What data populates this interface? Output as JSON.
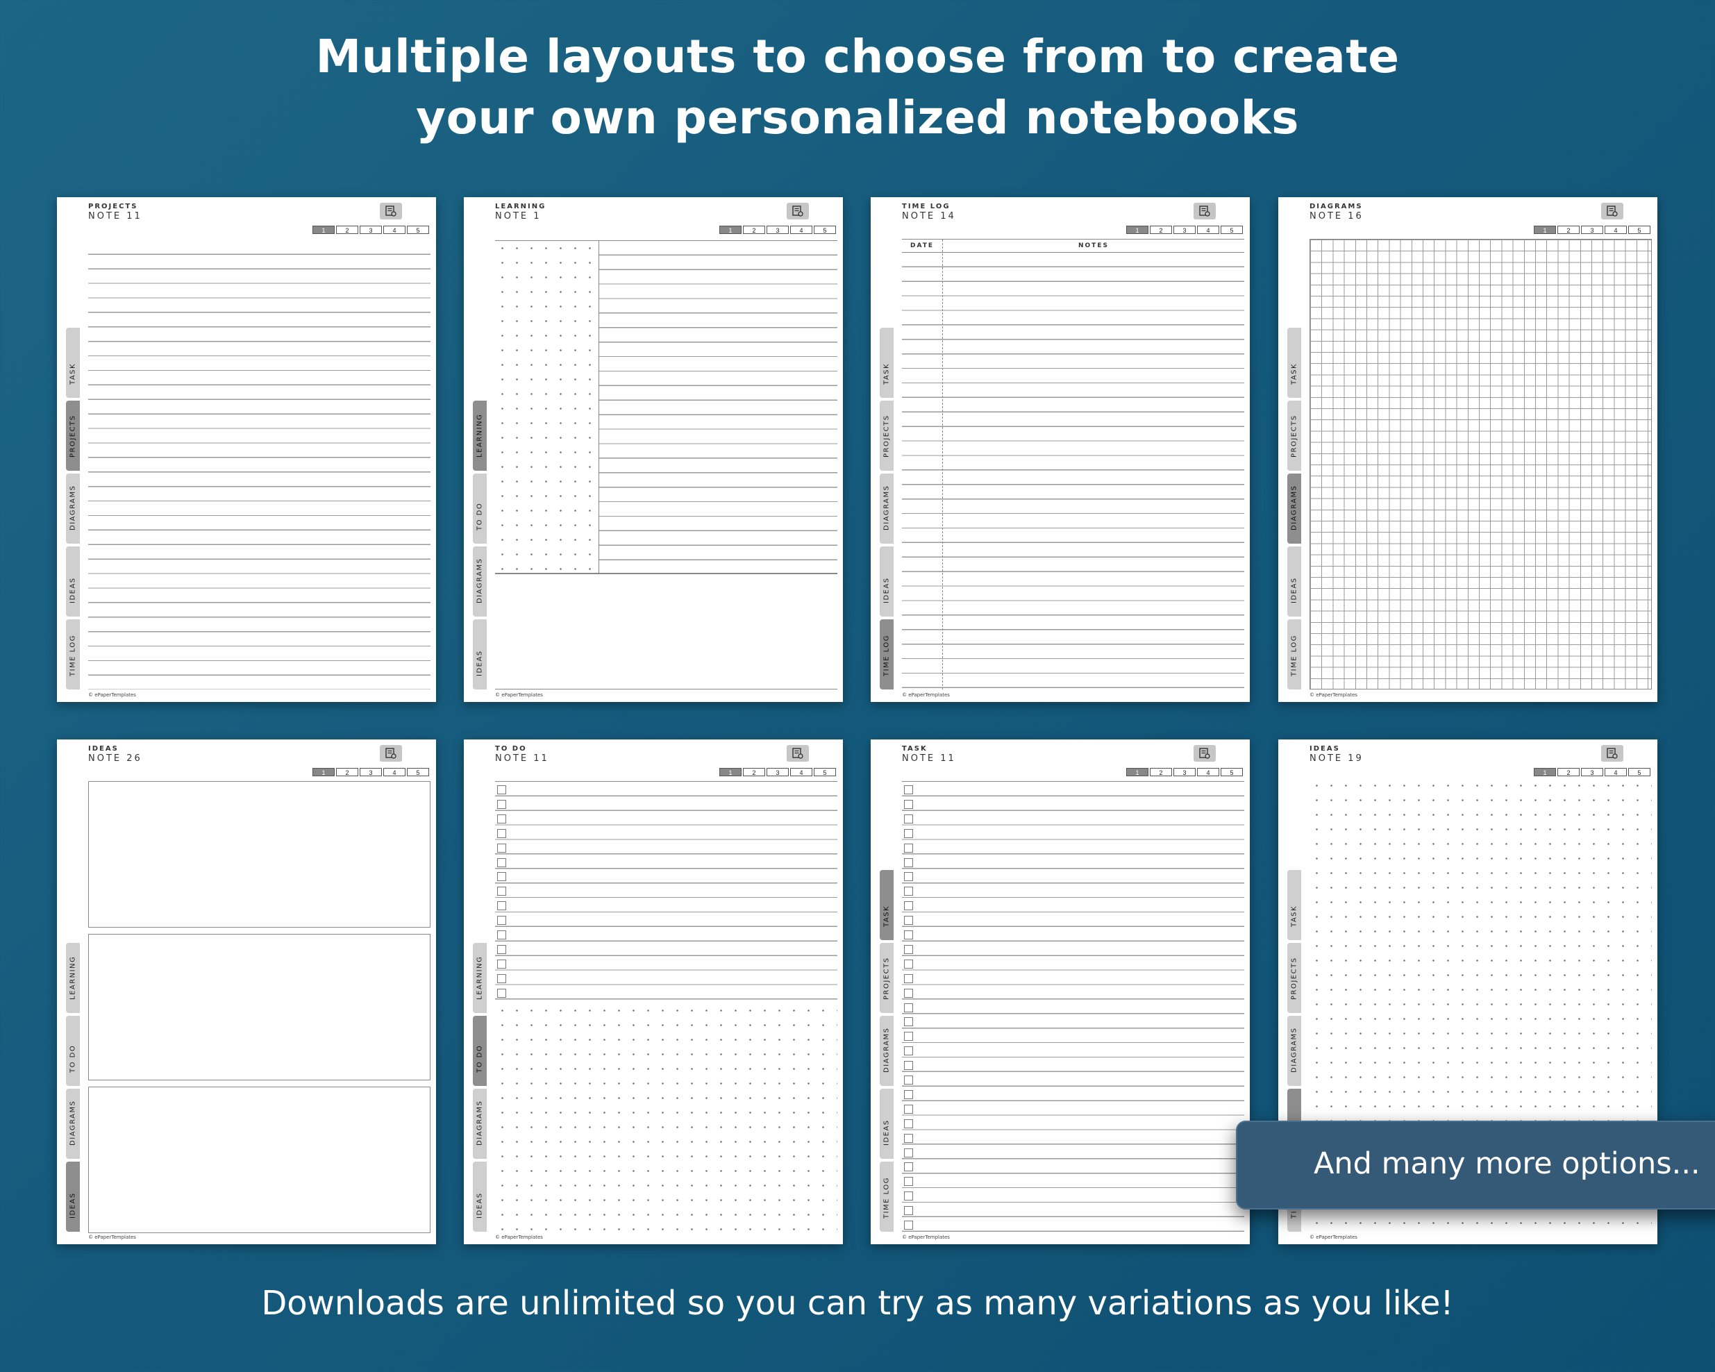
{
  "headline": {
    "line1": "Multiple layouts to choose from to create",
    "line2": "your own personalized notebooks"
  },
  "footer": "Downloads are unlimited so you can try as many variations as you like!",
  "overlay": "And many more options...",
  "icons": {
    "menu": "notebook-settings-icon"
  },
  "colors": {
    "background": "#155a7c",
    "tab": "#cfcfcf",
    "tab_active": "#8e8e8e",
    "pill": "#355a78"
  },
  "pages": [
    {
      "category": "PROJECTS",
      "note": "NOTE 11",
      "pager": [
        "1",
        "2",
        "3",
        "4",
        "5"
      ],
      "active_page": "1",
      "tabs": [
        "TASK",
        "PROJECTS",
        "DIAGRAMS",
        "IDEAS",
        "TIME LOG"
      ],
      "active_tab": "PROJECTS",
      "layout": "lined",
      "copyright": "© ePaperTemplates"
    },
    {
      "category": "LEARNING",
      "note": "NOTE 1",
      "pager": [
        "1",
        "2",
        "3",
        "4",
        "5"
      ],
      "active_page": "1",
      "tabs": [
        "LEARNING",
        "TO DO",
        "DIAGRAMS",
        "IDEAS"
      ],
      "active_tab": "LEARNING",
      "layout": "dots-and-lines",
      "copyright": "© ePaperTemplates"
    },
    {
      "category": "TIME LOG",
      "note": "NOTE 14",
      "pager": [
        "1",
        "2",
        "3",
        "4",
        "5"
      ],
      "active_page": "1",
      "tabs": [
        "TASK",
        "PROJECTS",
        "DIAGRAMS",
        "IDEAS",
        "TIME LOG"
      ],
      "active_tab": "TIME LOG",
      "layout": "time-log",
      "headers": [
        "DATE",
        "NOTES"
      ],
      "copyright": "© ePaperTemplates"
    },
    {
      "category": "DIAGRAMS",
      "note": "NOTE 16",
      "pager": [
        "1",
        "2",
        "3",
        "4",
        "5"
      ],
      "active_page": "1",
      "tabs": [
        "TASK",
        "PROJECTS",
        "DIAGRAMS",
        "IDEAS",
        "TIME LOG"
      ],
      "active_tab": "DIAGRAMS",
      "layout": "grid",
      "copyright": "© ePaperTemplates"
    },
    {
      "category": "IDEAS",
      "note": "NOTE 26",
      "pager": [
        "1",
        "2",
        "3",
        "4",
        "5"
      ],
      "active_page": "1",
      "tabs": [
        "LEARNING",
        "TO DO",
        "DIAGRAMS",
        "IDEAS"
      ],
      "active_tab": "IDEAS",
      "layout": "boxes",
      "copyright": "© ePaperTemplates"
    },
    {
      "category": "TO DO",
      "note": "NOTE 11",
      "pager": [
        "1",
        "2",
        "3",
        "4",
        "5"
      ],
      "active_page": "1",
      "tabs": [
        "LEARNING",
        "TO DO",
        "DIAGRAMS",
        "IDEAS"
      ],
      "active_tab": "TO DO",
      "layout": "todo-dots",
      "copyright": "© ePaperTemplates"
    },
    {
      "category": "TASK",
      "note": "NOTE 11",
      "pager": [
        "1",
        "2",
        "3",
        "4",
        "5"
      ],
      "active_page": "1",
      "tabs": [
        "TASK",
        "PROJECTS",
        "DIAGRAMS",
        "IDEAS",
        "TIME LOG"
      ],
      "active_tab": "TASK",
      "layout": "checklist",
      "copyright": "© ePaperTemplates"
    },
    {
      "category": "IDEAS",
      "note": "NOTE 19",
      "pager": [
        "1",
        "2",
        "3",
        "4",
        "5"
      ],
      "active_page": "1",
      "tabs": [
        "TASK",
        "PROJECTS",
        "DIAGRAMS",
        "IDEAS",
        "TIME LOG"
      ],
      "active_tab": "IDEAS",
      "layout": "dots",
      "copyright": "© ePaperTemplates"
    }
  ]
}
